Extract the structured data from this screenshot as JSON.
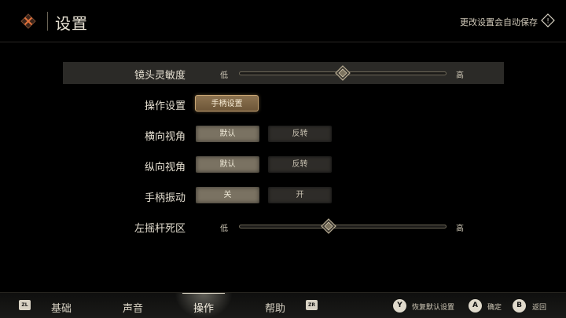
{
  "header": {
    "title": "设置",
    "autosave_text": "更改设置会自动保存",
    "warn_glyph": "!"
  },
  "rows": {
    "camera_sensitivity": {
      "label": "镜头灵敏度",
      "low": "低",
      "high": "高",
      "value": 0.5
    },
    "controls": {
      "label": "操作设置",
      "button": "手柄设置"
    },
    "horizontal_view": {
      "label": "横向视角",
      "options": [
        "默认",
        "反转"
      ],
      "selected": 0
    },
    "vertical_view": {
      "label": "纵向视角",
      "options": [
        "默认",
        "反转"
      ],
      "selected": 0
    },
    "vibration": {
      "label": "手柄振动",
      "options": [
        "关",
        "开"
      ],
      "selected": 0
    },
    "left_stick_deadzone": {
      "label": "左摇杆死区",
      "low": "低",
      "high": "高",
      "value": 0.43
    }
  },
  "bottom": {
    "zl": "ZL",
    "zr": "ZR",
    "tabs": [
      "基础",
      "声音",
      "操作",
      "帮助"
    ],
    "active_tab": 2,
    "actions": [
      {
        "key": "Y",
        "label": "恢复默认设置"
      },
      {
        "key": "A",
        "label": "确定"
      },
      {
        "key": "B",
        "label": "返回"
      }
    ]
  },
  "colors": {
    "accent": "#c8a574",
    "close_icon": "#e0703a"
  }
}
